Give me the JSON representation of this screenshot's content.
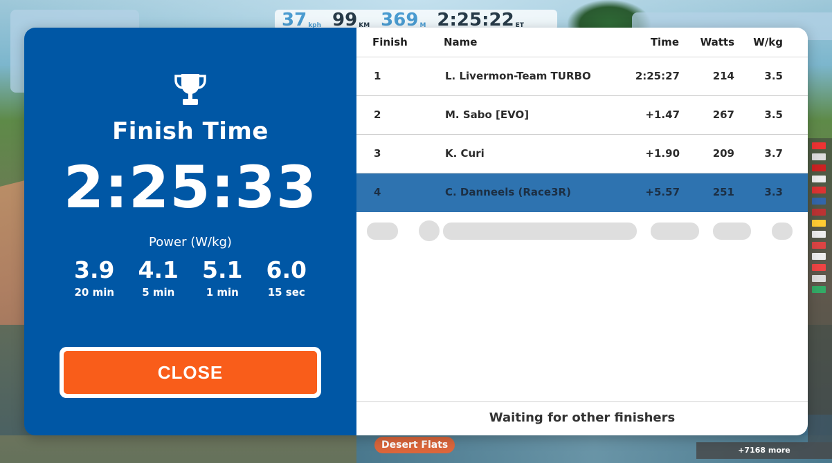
{
  "hud": {
    "speed_value": "37",
    "speed_unit": "kph",
    "distance_value": "99",
    "distance_unit": "KM",
    "elevation_value": "369",
    "elevation_unit": "M",
    "elapsed_value": "2:25:22",
    "elapsed_unit": "ET",
    "world_label": "Desert Flats",
    "more_riders": "+7168 more"
  },
  "summary": {
    "title": "Finish Time",
    "finish_time": "2:25:33",
    "power_label": "Power (W/kg)",
    "power": [
      {
        "value": "3.9",
        "duration": "20 min"
      },
      {
        "value": "4.1",
        "duration": "5 min"
      },
      {
        "value": "5.1",
        "duration": "1 min"
      },
      {
        "value": "6.0",
        "duration": "15 sec"
      }
    ],
    "close_label": "CLOSE"
  },
  "results": {
    "columns": {
      "finish": "Finish",
      "name": "Name",
      "time": "Time",
      "watts": "Watts",
      "wkg": "W/kg"
    },
    "rows": [
      {
        "finish": "1",
        "name": "L. Livermon-Team TURBO",
        "time": "2:25:27",
        "watts": "214",
        "wkg": "3.5"
      },
      {
        "finish": "2",
        "name": "M. Sabo [EVO]",
        "time": "+1.47",
        "watts": "267",
        "wkg": "3.5"
      },
      {
        "finish": "3",
        "name": "K. Curi",
        "time": "+1.90",
        "watts": "209",
        "wkg": "3.7"
      },
      {
        "finish": "4",
        "name": "C. Danneels (Race3R)",
        "time": "+5.57",
        "watts": "251",
        "wkg": "3.3",
        "highlighted": true
      }
    ],
    "footer": "Waiting for other finishers"
  },
  "colors": {
    "panel_blue": "#0057a5",
    "highlight_row": "#2e73b0",
    "close_orange": "#f95d1a"
  },
  "icons": {
    "trophy": "trophy-icon"
  }
}
